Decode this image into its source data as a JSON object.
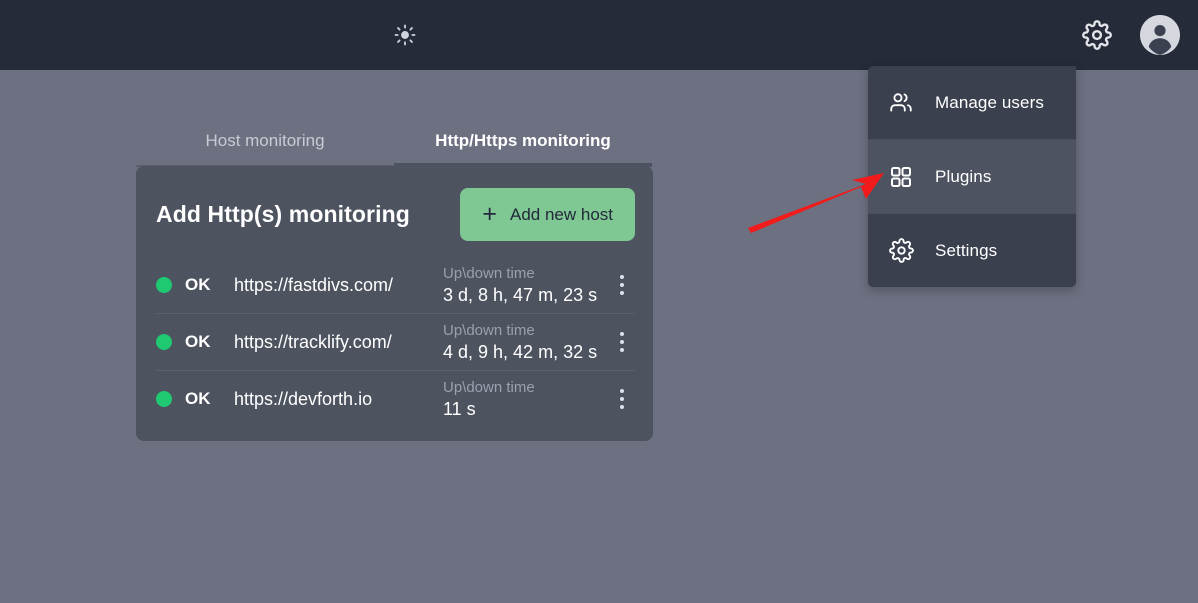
{
  "topbar": {
    "theme_toggle_icon": "sun-icon",
    "settings_icon": "gear-icon",
    "avatar_icon": "user-avatar-icon"
  },
  "dropdown": {
    "items": [
      {
        "label": "Manage users",
        "icon": "users-icon",
        "highlighted": false
      },
      {
        "label": "Plugins",
        "icon": "grid-squares-icon",
        "highlighted": true
      },
      {
        "label": "Settings",
        "icon": "gear-icon",
        "highlighted": false
      }
    ]
  },
  "tabs": [
    {
      "label": "Host monitoring",
      "active": false
    },
    {
      "label": "Http/Https monitoring",
      "active": true
    }
  ],
  "card": {
    "title": "Add Http(s) monitoring",
    "add_button": {
      "label": "Add new host",
      "plus": "+",
      "color": "#7fc894"
    },
    "uptime_label": "Up\\down time",
    "status_color": "#1ec971",
    "rows": [
      {
        "status": "OK",
        "url": "https://fastdivs.com/",
        "uptime_label": "Up\\down time",
        "uptime": "3 d, 8 h, 47 m, 23 s"
      },
      {
        "status": "OK",
        "url": "https://tracklify.com/",
        "uptime_label": "Up\\down time",
        "uptime": "4 d, 9 h, 42 m, 32 s"
      },
      {
        "status": "OK",
        "url": "https://devforth.io",
        "uptime_label": "Up\\down time",
        "uptime": "11 s"
      }
    ]
  },
  "annotation": {
    "arrow_color": "#f21b1b",
    "points_to": "Plugins"
  }
}
